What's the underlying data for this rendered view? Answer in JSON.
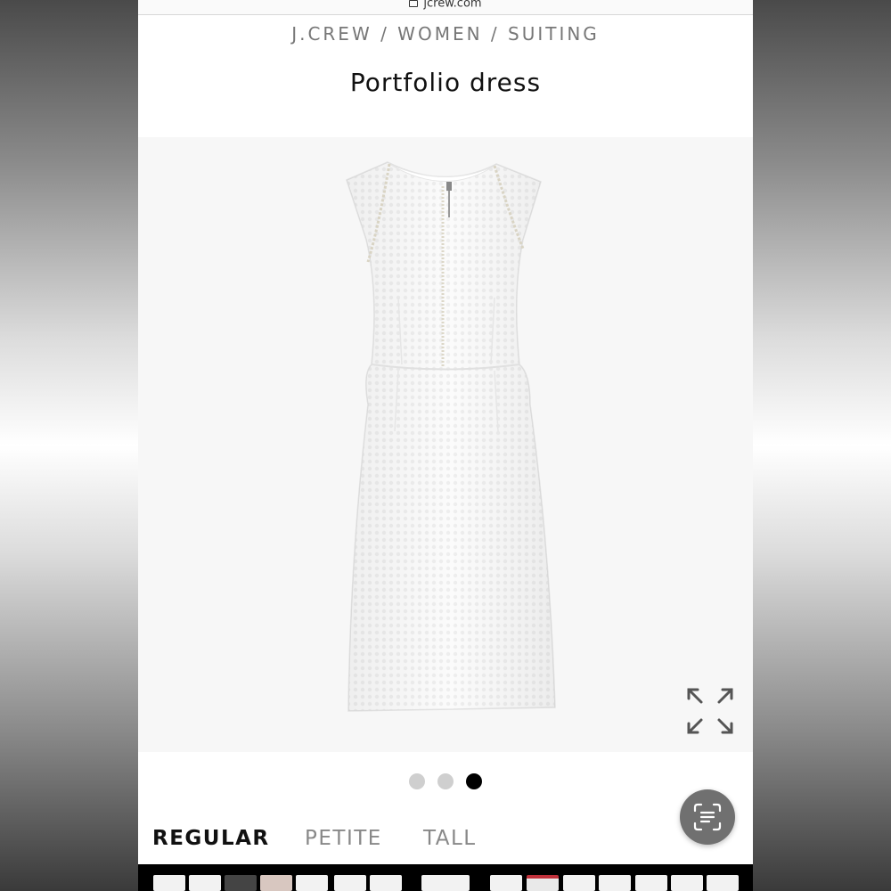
{
  "browser": {
    "url": "jcrew.com"
  },
  "breadcrumb": {
    "brand": "J.CREW",
    "separator": " / ",
    "category": "WOMEN",
    "subcategory": "SUITING"
  },
  "product": {
    "title": "Portfolio dress",
    "image_alt_icon": "dress-photo",
    "expand_icon": "expand-icon"
  },
  "carousel": {
    "total": 3,
    "active_index": 2
  },
  "fit_tabs": [
    {
      "label": "REGULAR",
      "active": true
    },
    {
      "label": "PETITE",
      "active": false
    },
    {
      "label": "TALL",
      "active": false
    }
  ],
  "scan_button": {
    "icon": "text-scan-icon"
  },
  "colors": {
    "page_bg": "#ffffff",
    "image_bg": "#f7f7f7",
    "active_dot": "#000000",
    "inactive_dot": "#cfcfcf",
    "fab_bg": "#707070"
  }
}
